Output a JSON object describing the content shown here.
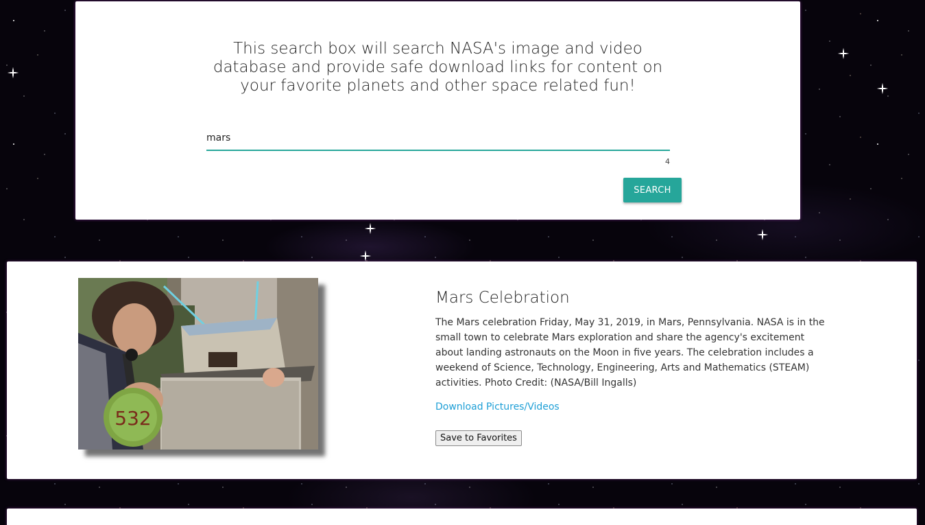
{
  "search": {
    "intro": "This search box will search NASA's image and video database and provide safe download links for content on your favorite planets and other space related fun!",
    "query": "mars",
    "char_count": "4",
    "button_label": "SEARCH"
  },
  "results": [
    {
      "title": "Mars Celebration",
      "description": "The Mars celebration Friday, May 31, 2019, in Mars, Pennsylvania. NASA is in the small town to celebrate Mars exploration and share the agency's excitement about landing astronauts on the Moon in five years. The celebration includes a weekend of Science, Technology, Engineering, Arts and Mathematics (STEAM) activities. Photo Credit: (NASA/Bill Ingalls)",
      "download_label": "Download Pictures/Videos",
      "favorite_label": "Save to Favorites",
      "image_badge": "532"
    }
  ],
  "colors": {
    "accent": "#26a69a",
    "link": "#1e9fd6",
    "background": "#07040c"
  }
}
